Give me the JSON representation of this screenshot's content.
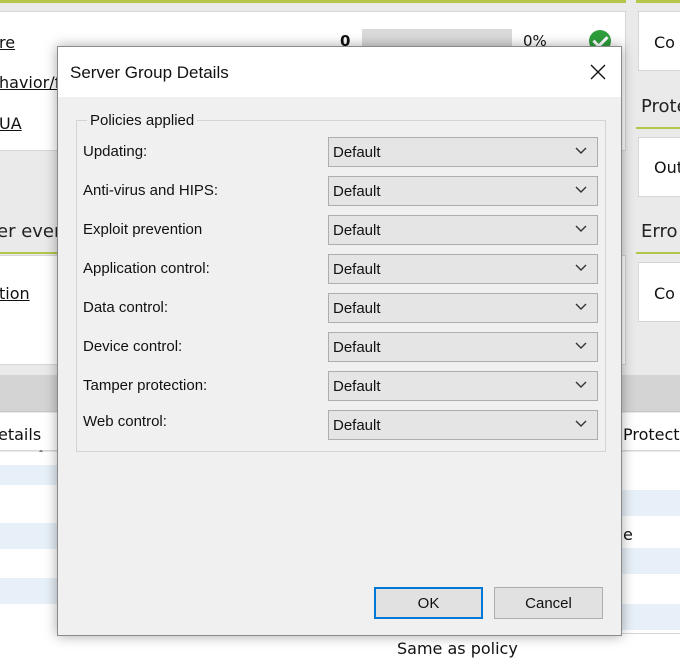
{
  "background": {
    "links": [
      "re",
      "havior/fi",
      "UA",
      "tion"
    ],
    "count": "0",
    "percent": "0%",
    "section_left": "er ever",
    "right_cards": [
      "Co",
      "Out",
      "Co"
    ],
    "right_sections": [
      "Prote",
      "Erro"
    ],
    "table_headers": {
      "left": "etails",
      "right": "Protect"
    },
    "cell_fragment": "e",
    "footer_value": "Same as policy"
  },
  "dialog": {
    "title": "Server Group Details",
    "group_title": "Policies applied",
    "policies": [
      {
        "label": "Updating:",
        "value": "Default"
      },
      {
        "label": "Anti-virus and HIPS:",
        "value": "Default"
      },
      {
        "label": "Exploit prevention",
        "value": "Default"
      },
      {
        "label": "Application control:",
        "value": "Default"
      },
      {
        "label": "Data control:",
        "value": "Default"
      },
      {
        "label": "Device control:",
        "value": "Default"
      },
      {
        "label": "Tamper protection:",
        "value": "Default"
      },
      {
        "label": "Web control:",
        "value": "Default"
      }
    ],
    "ok_label": "OK",
    "cancel_label": "Cancel"
  },
  "colors": {
    "accent": "#b6c64a",
    "focus": "#0078d7",
    "success": "#2e9e3c"
  }
}
